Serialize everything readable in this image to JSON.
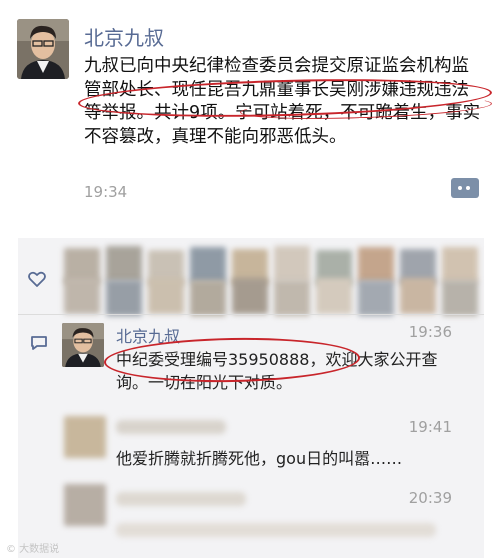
{
  "post": {
    "author": "北京九叔",
    "text": "九叔已向中央纪律检查委员会提交原证监会机构监管部处长、现任昆吾九鼎董事长吴刚涉嫌违规违法等举报。共计9项。宁可站着死，不可跪着生，事实不容篡改，真理不能向邪恶低头。",
    "time": "19:34",
    "more_icon": "comment-more-icon"
  },
  "likes": {
    "icon": "heart-icon"
  },
  "comments": {
    "icon": "comment-icon",
    "items": [
      {
        "name": "北京九叔",
        "time": "19:36",
        "text": "中纪委受理编号35950888，欢迎大家公开查询。一切在阳光下对质。"
      },
      {
        "name": "",
        "time": "19:41",
        "text": "他爱折腾就折腾死他，gou日的叫嚣……"
      },
      {
        "name": "",
        "time": "20:39",
        "text": ""
      }
    ]
  },
  "watermark": "© 大数据说",
  "colors": {
    "name": "#586b94",
    "annotation": "#c8252b",
    "panel": "#f3f3f5"
  }
}
